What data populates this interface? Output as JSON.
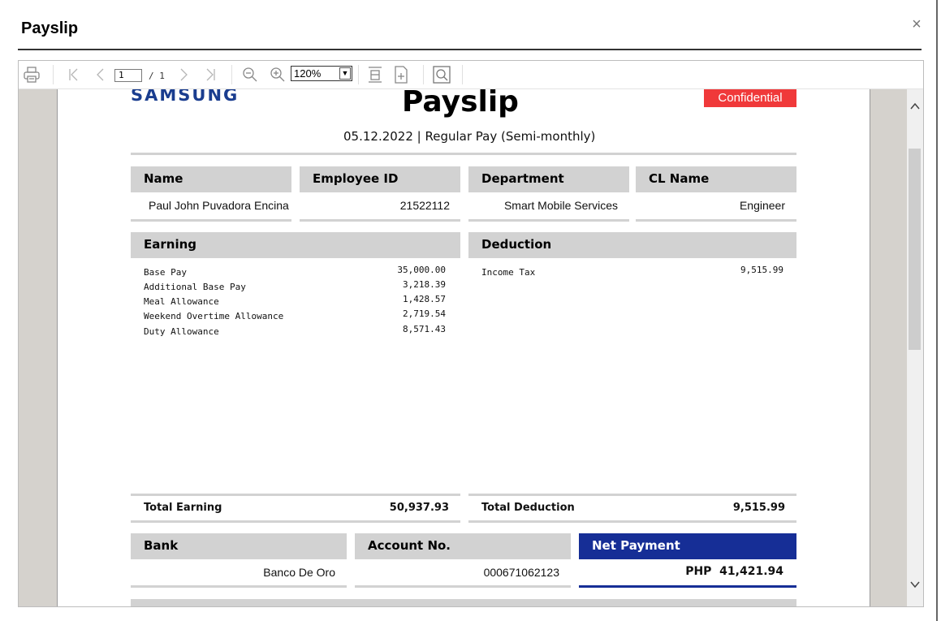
{
  "dialog": {
    "title": "Payslip",
    "close_label": "×"
  },
  "toolbar": {
    "page_current": "1",
    "page_total": "/ 1",
    "zoom": "120%",
    "zoom_arrow": "▼"
  },
  "payslip": {
    "logo": "SAMSUNG",
    "title": "Payslip",
    "badge": "Confidential",
    "subtitle": "05.12.2022 | Regular Pay (Semi-monthly)",
    "info_headers": [
      "Name",
      "Employee ID",
      "Department",
      "CL Name"
    ],
    "info_values": [
      "Paul John Puvadora Encina",
      "21522112",
      "Smart Mobile Services",
      "Engineer"
    ],
    "earning_header": "Earning",
    "deduction_header": "Deduction",
    "earnings": [
      {
        "label": "Base Pay",
        "amount": "35,000.00"
      },
      {
        "label": "Additional Base Pay",
        "amount": "3,218.39"
      },
      {
        "label": "Meal Allowance",
        "amount": "1,428.57"
      },
      {
        "label": "Weekend Overtime Allowance",
        "amount": "2,719.54"
      },
      {
        "label": "Duty Allowance",
        "amount": "8,571.43"
      }
    ],
    "deductions": [
      {
        "label": "Income Tax",
        "amount": "9,515.99"
      }
    ],
    "total_earning_label": "Total Earning",
    "total_earning": "50,937.93",
    "total_deduction_label": "Total Deduction",
    "total_deduction": "9,515.99",
    "bank_header": "Bank",
    "account_header": "Account No.",
    "net_header": "Net Payment",
    "bank": "Banco De Oro",
    "account_no": "000671062123",
    "net_payment": "PHP  41,421.94"
  },
  "colors": {
    "brand": "#1a3d8f",
    "badge": "#f0393a",
    "net": "#162e96"
  }
}
